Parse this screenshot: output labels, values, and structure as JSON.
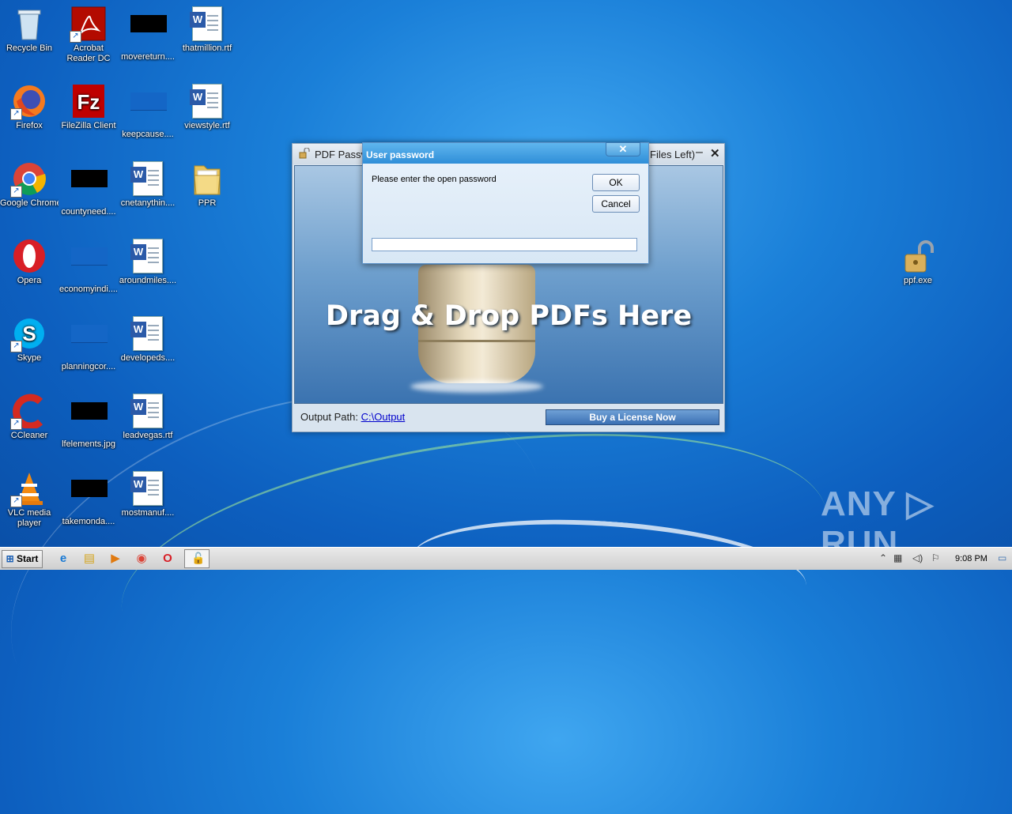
{
  "desktop": {
    "icons": [
      {
        "label": "Recycle Bin"
      },
      {
        "label": "Acrobat Reader DC"
      },
      {
        "label": "movereturn...."
      },
      {
        "label": "thatmillion.rtf"
      },
      {
        "label": "Firefox"
      },
      {
        "label": "FileZilla Client"
      },
      {
        "label": "keepcause...."
      },
      {
        "label": "viewstyle.rtf"
      },
      {
        "label": "Google Chrome"
      },
      {
        "label": "countyneed...."
      },
      {
        "label": "cnetanythin...."
      },
      {
        "label": "PPR"
      },
      {
        "label": "Opera"
      },
      {
        "label": "economyindi...."
      },
      {
        "label": "aroundmiles...."
      },
      {
        "label": "Skype"
      },
      {
        "label": "planningcor...."
      },
      {
        "label": "developeds...."
      },
      {
        "label": "CCleaner"
      },
      {
        "label": "lfelements.jpg"
      },
      {
        "label": "leadvegas.rtf"
      },
      {
        "label": "VLC media player"
      },
      {
        "label": "takemonda...."
      },
      {
        "label": "mostmanuf...."
      },
      {
        "label": "ppf.exe"
      }
    ]
  },
  "app_window": {
    "title": "PDF Passv",
    "title_right": "Files Left)",
    "minimize": "–",
    "close": "✕",
    "drop_text": "Drag & Drop PDFs Here",
    "output_label": "Output Path:",
    "output_path": "C:\\Output",
    "buy_button": "Buy a License Now"
  },
  "dialog": {
    "title": "User password",
    "close": "✕",
    "prompt": "Please enter the open password",
    "ok": "OK",
    "cancel": "Cancel",
    "password_value": ""
  },
  "watermark": "ANY ▷ RUN",
  "taskbar": {
    "start": "Start",
    "clock": "9:08 PM"
  }
}
